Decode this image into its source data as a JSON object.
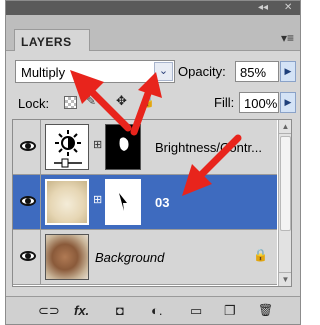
{
  "titlebar": {
    "collapse_glyph": "◂◂",
    "close_glyph": "✕"
  },
  "panel": {
    "tab_label": "LAYERS",
    "menu_glyph": "▾≡"
  },
  "blend": {
    "mode": "Multiply",
    "dropdown_glyph": "⌄"
  },
  "opacity": {
    "label": "Opacity:",
    "value": "85%",
    "arrow": "▶"
  },
  "lock": {
    "label": "Lock:"
  },
  "fill": {
    "label": "Fill:",
    "value": "100%",
    "arrow": "▶"
  },
  "layers": [
    {
      "name": "Brightness/Contr...",
      "kind": "adjustment",
      "selected": false
    },
    {
      "name": "03",
      "kind": "image",
      "selected": true
    },
    {
      "name": "Background",
      "kind": "background",
      "selected": false,
      "locked": true
    }
  ],
  "bottom_bar": {
    "link": "⊂⊃",
    "fx": "fx.",
    "mask": "◘",
    "adjust": "◐.",
    "folder": "▭",
    "new": "❐",
    "trash": "🗑"
  },
  "annotations": {
    "arrow_color": "#e8241c"
  },
  "colors": {
    "selection": "#3e6bbf",
    "panel_bg": "#d6d6d6"
  }
}
